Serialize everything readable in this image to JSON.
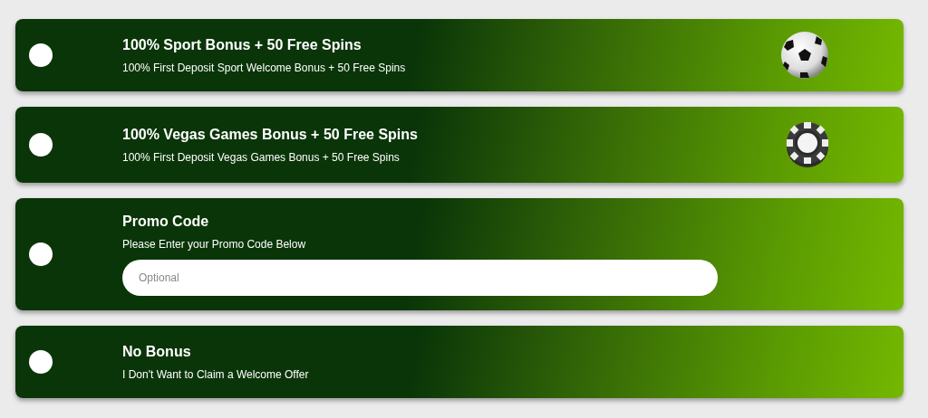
{
  "options": [
    {
      "kind": "sport",
      "selected": false,
      "title": "100% Sport Bonus + 50 Free Spins",
      "subtitle": "100% First Deposit Sport Welcome Bonus + 50 Free Spins"
    },
    {
      "kind": "vegas",
      "selected": false,
      "title": "100% Vegas Games Bonus + 50 Free Spins",
      "subtitle": "100% First Deposit Vegas Games Bonus + 50 Free Spins"
    },
    {
      "kind": "promo",
      "selected": false,
      "title": "Promo Code",
      "subtitle": "Please Enter your Promo Code Below",
      "placeholder": "Optional"
    },
    {
      "kind": "plain",
      "selected": false,
      "title": "No Bonus",
      "subtitle": "I Don't Want to Claim a Welcome Offer"
    }
  ]
}
